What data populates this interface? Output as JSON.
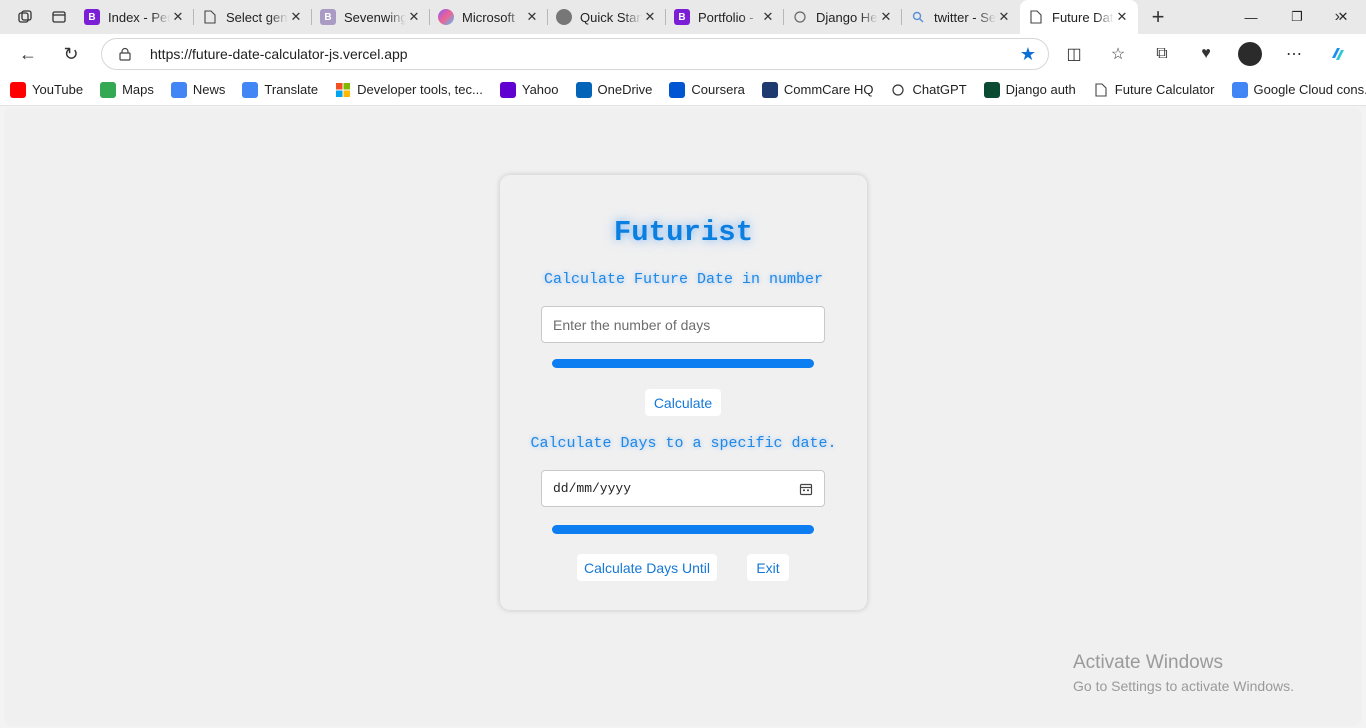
{
  "browser": {
    "tabs": [
      {
        "title": "Index - Per",
        "icon": "bootstrap-icon",
        "color": "#7b1fd6"
      },
      {
        "title": "Select gen",
        "icon": "page-icon",
        "color": ""
      },
      {
        "title": "Sevenwing",
        "icon": "bootstrap-icon",
        "color": "#a99bc4"
      },
      {
        "title": "Microsoft",
        "icon": "copilot-icon",
        "color": ""
      },
      {
        "title": "Quick Start",
        "icon": "site-icon",
        "color": "#777777"
      },
      {
        "title": "Portfolio -",
        "icon": "bootstrap-icon",
        "color": "#7b1fd6"
      },
      {
        "title": "Django He",
        "icon": "openai-icon",
        "color": ""
      },
      {
        "title": "twitter - Se",
        "icon": "search-icon",
        "color": ""
      },
      {
        "title": "Future Dat",
        "icon": "page-icon",
        "color": "",
        "active": true
      }
    ],
    "url": "https://future-date-calculator-js.vercel.app",
    "bookmarks": [
      {
        "label": "YouTube",
        "icon": "youtube-icon",
        "color": "#ff0000"
      },
      {
        "label": "Maps",
        "icon": "maps-icon",
        "color": "#34a853"
      },
      {
        "label": "News",
        "icon": "news-icon",
        "color": "#4285f4"
      },
      {
        "label": "Translate",
        "icon": "translate-icon",
        "color": "#4285f4"
      },
      {
        "label": "Developer tools, tec...",
        "icon": "microsoft-icon",
        "color": "#f25022"
      },
      {
        "label": "Yahoo",
        "icon": "yahoo-icon",
        "color": "#6001d2"
      },
      {
        "label": "OneDrive",
        "icon": "onedrive-icon",
        "color": "#0364b8"
      },
      {
        "label": "Coursera",
        "icon": "coursera-icon",
        "color": "#0056d2"
      },
      {
        "label": "CommCare HQ",
        "icon": "commcare-icon",
        "color": "#1f3a6e"
      },
      {
        "label": "ChatGPT",
        "icon": "openai-icon",
        "color": "#333333"
      },
      {
        "label": "Django auth",
        "icon": "django-icon",
        "color": "#0c4b33"
      },
      {
        "label": "Future Calculator",
        "icon": "page-icon",
        "color": "#555555"
      },
      {
        "label": "Google Cloud cons...",
        "icon": "google-cloud-icon",
        "color": "#4285f4"
      }
    ]
  },
  "app": {
    "title": "Futurist",
    "section1_heading": "Calculate Future Date in number",
    "days_placeholder": "Enter the number of days",
    "calculate_label": "Calculate",
    "section2_heading": "Calculate Days to a specific date.",
    "date_placeholder": "dd/mm/yyyy",
    "calc_until_label": "Calculate Days Until",
    "exit_label": "Exit",
    "accent_color": "#0d7ef2"
  },
  "watermark": {
    "line1": "Activate Windows",
    "line2": "Go to Settings to activate Windows."
  }
}
